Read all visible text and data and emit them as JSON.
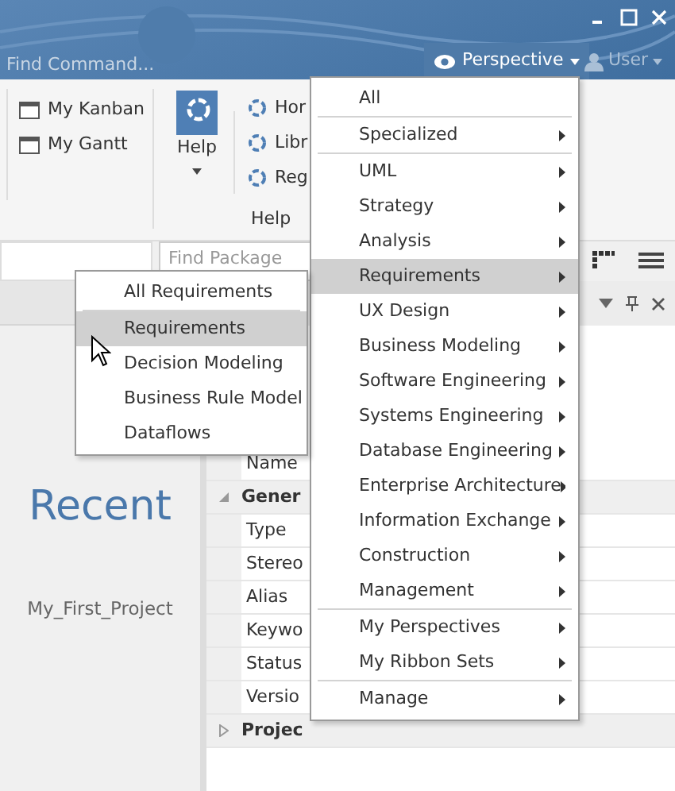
{
  "title_bar": {
    "search_placeholder": "Find Command...",
    "perspective_button": "Perspective",
    "user_button": "User"
  },
  "ribbon": {
    "left_items": [
      {
        "label": "My Kanban"
      },
      {
        "label": "My Gantt"
      }
    ],
    "help_button": "Help",
    "help_links": [
      {
        "label": "Hor"
      },
      {
        "label": "Libr"
      },
      {
        "label": "Reg"
      }
    ],
    "group_label": "Help"
  },
  "toolbar": {
    "package_placeholder": "Find Package"
  },
  "start_panel": {
    "heading": "Recent",
    "recent_items": [
      "My_First_Project"
    ]
  },
  "properties": {
    "rows": [
      {
        "kind": "row",
        "label": "Name"
      },
      {
        "kind": "group",
        "label": "Gener",
        "expanded": true
      },
      {
        "kind": "row",
        "label": "Type"
      },
      {
        "kind": "row",
        "label": "Stereo"
      },
      {
        "kind": "row",
        "label": "Alias"
      },
      {
        "kind": "row",
        "label": "Keywo"
      },
      {
        "kind": "row",
        "label": "Status"
      },
      {
        "kind": "row",
        "label": "Versio"
      },
      {
        "kind": "group",
        "label": "Projec",
        "expanded": false
      }
    ]
  },
  "perspective_menu": {
    "groups": [
      [
        {
          "label": "All",
          "submenu": false,
          "selected": false
        }
      ],
      [
        {
          "label": "Specialized",
          "submenu": true,
          "selected": false
        }
      ],
      [
        {
          "label": "UML",
          "submenu": true,
          "selected": false
        },
        {
          "label": "Strategy",
          "submenu": true,
          "selected": false
        },
        {
          "label": "Analysis",
          "submenu": true,
          "selected": false
        },
        {
          "label": "Requirements",
          "submenu": true,
          "selected": true
        },
        {
          "label": "UX Design",
          "submenu": true,
          "selected": false
        },
        {
          "label": "Business Modeling",
          "submenu": true,
          "selected": false
        },
        {
          "label": "Software Engineering",
          "submenu": true,
          "selected": false
        },
        {
          "label": "Systems Engineering",
          "submenu": true,
          "selected": false
        },
        {
          "label": "Database Engineering",
          "submenu": true,
          "selected": false
        },
        {
          "label": "Enterprise Architecture",
          "submenu": true,
          "selected": false
        },
        {
          "label": "Information Exchange",
          "submenu": true,
          "selected": false
        },
        {
          "label": "Construction",
          "submenu": true,
          "selected": false
        },
        {
          "label": "Management",
          "submenu": true,
          "selected": false
        }
      ],
      [
        {
          "label": "My Perspectives",
          "submenu": true,
          "selected": false
        },
        {
          "label": "My Ribbon Sets",
          "submenu": true,
          "selected": false
        }
      ],
      [
        {
          "label": "Manage",
          "submenu": true,
          "selected": false
        }
      ]
    ]
  },
  "sub_menu": {
    "groups": [
      [
        {
          "label": "All Requirements",
          "selected": false
        }
      ],
      [
        {
          "label": "Requirements",
          "selected": true
        },
        {
          "label": "Decision Modeling",
          "selected": false
        },
        {
          "label": "Business Rule Model",
          "selected": false
        },
        {
          "label": "Dataflows",
          "selected": false
        }
      ]
    ]
  }
}
